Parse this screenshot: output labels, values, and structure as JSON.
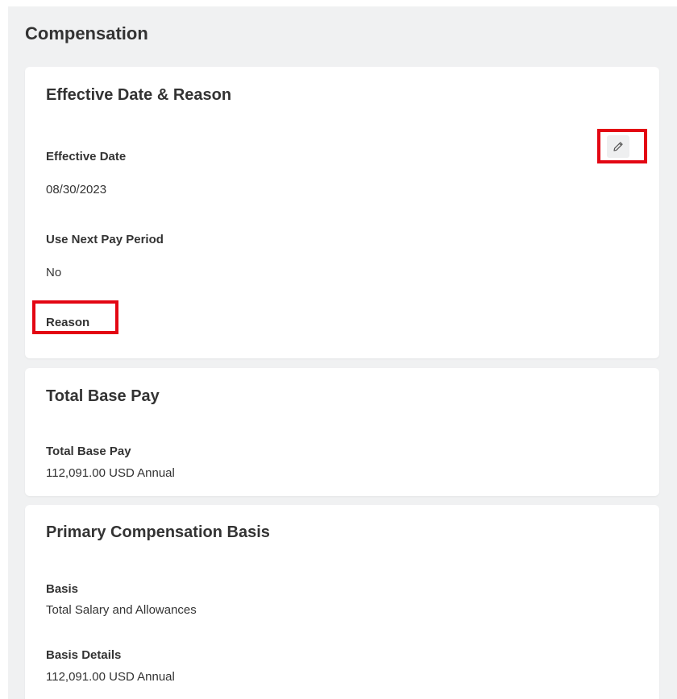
{
  "page": {
    "title": "Compensation"
  },
  "effective_section": {
    "title": "Effective Date & Reason",
    "edit_icon": "pencil-icon",
    "fields": [
      {
        "label": "Effective Date",
        "value": "08/30/2023"
      },
      {
        "label": "Use Next Pay Period",
        "value": "No"
      },
      {
        "label": "Reason",
        "value": ""
      }
    ]
  },
  "total_base_pay_section": {
    "title": "Total Base Pay",
    "fields": [
      {
        "label": "Total Base Pay",
        "value": "112,091.00 USD Annual"
      }
    ]
  },
  "primary_basis_section": {
    "title": "Primary Compensation Basis",
    "fields": [
      {
        "label": "Basis",
        "value": "Total Salary and Allowances"
      },
      {
        "label": "Basis Details",
        "value": "112,091.00 USD Annual"
      }
    ]
  },
  "colors": {
    "background": "#f0f1f2",
    "card": "#ffffff",
    "text": "#333333",
    "highlight": "#e30613"
  }
}
